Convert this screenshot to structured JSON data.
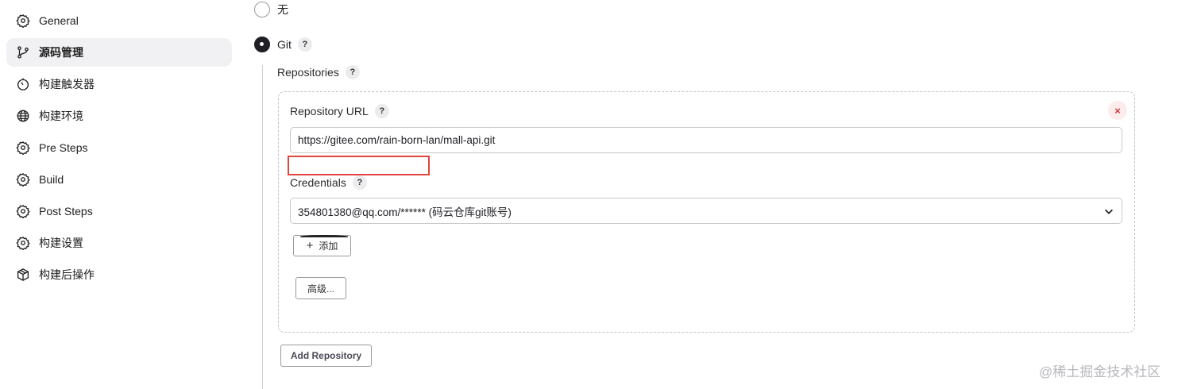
{
  "sidebar": {
    "items": [
      {
        "label": "General",
        "icon": "gear-icon"
      },
      {
        "label": "源码管理",
        "icon": "branch-icon",
        "active": true
      },
      {
        "label": "构建触发器",
        "icon": "timer-icon"
      },
      {
        "label": "构建环境",
        "icon": "globe-icon"
      },
      {
        "label": "Pre Steps",
        "icon": "gear-icon"
      },
      {
        "label": "Build",
        "icon": "gear-icon"
      },
      {
        "label": "Post Steps",
        "icon": "gear-icon"
      },
      {
        "label": "构建设置",
        "icon": "gear-icon"
      },
      {
        "label": "构建后操作",
        "icon": "package-icon"
      }
    ]
  },
  "scm": {
    "option_none": "无",
    "option_git": "Git",
    "help": "?"
  },
  "repositories": {
    "label": "Repositories",
    "url_label": "Repository URL",
    "url_value": "https://gitee.com/rain-born-lan/mall-api.git",
    "remove_symbol": "×",
    "credentials_label": "Credentials",
    "credentials_value": "354801380@qq.com/****** (码云仓库git账号)",
    "add_label": "添加",
    "add_symbol": "+",
    "advanced_label": "高级...",
    "add_repository_label": "Add Repository"
  },
  "watermark": "@稀土掘金技术社区",
  "colors": {
    "highlight": "#e0453f",
    "remove": "#d2353b",
    "active_bg": "#f1f1f3"
  }
}
